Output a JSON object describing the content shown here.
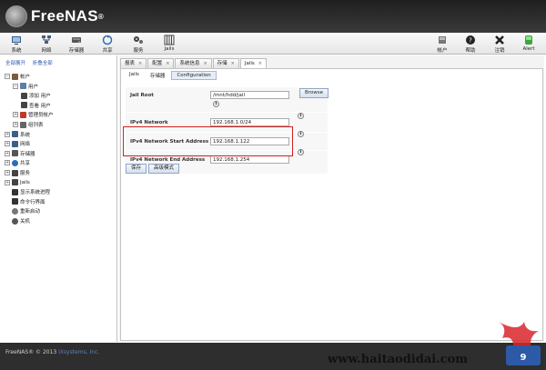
{
  "app": {
    "name": "FreeNAS",
    "trademark": "®"
  },
  "toolbar": {
    "left": [
      {
        "name": "toolbar-system-button",
        "icon": "system-icon",
        "label": "系统"
      },
      {
        "name": "toolbar-network-button",
        "icon": "network-icon",
        "label": "网络"
      },
      {
        "name": "toolbar-storage-button",
        "icon": "storage-icon",
        "label": "存储器"
      },
      {
        "name": "toolbar-sharing-button",
        "icon": "sharing-icon",
        "label": "共享"
      },
      {
        "name": "toolbar-services-button",
        "icon": "services-icon",
        "label": "服务"
      },
      {
        "name": "toolbar-jails-button",
        "icon": "jails-icon",
        "label": "Jails"
      }
    ],
    "right": [
      {
        "name": "toolbar-account-button",
        "icon": "account-icon",
        "label": "帐户"
      },
      {
        "name": "toolbar-help-button",
        "icon": "help-icon",
        "label": "帮助"
      },
      {
        "name": "toolbar-logout-button",
        "icon": "logout-icon",
        "label": "注销"
      },
      {
        "name": "toolbar-alert-button",
        "icon": "alert-icon",
        "label": "Alert"
      }
    ]
  },
  "sidebar": {
    "expand_all": "全部展开",
    "collapse_all": "折叠全部",
    "tree": [
      {
        "label": "帐户",
        "level": 0,
        "toggle": "−",
        "icon": "account-icon"
      },
      {
        "label": "用户",
        "level": 1,
        "toggle": "−",
        "icon": "users-icon"
      },
      {
        "label": "添加 用户",
        "level": 2,
        "toggle": "",
        "icon": "add-user-icon"
      },
      {
        "label": "查看 用户",
        "level": 2,
        "toggle": "",
        "icon": "view-users-icon"
      },
      {
        "label": "管理员帐户",
        "level": 1,
        "toggle": "+",
        "icon": "admin-icon"
      },
      {
        "label": "组列表",
        "level": 1,
        "toggle": "+",
        "icon": "groups-icon"
      },
      {
        "label": "系统",
        "level": 0,
        "toggle": "+",
        "icon": "system-icon"
      },
      {
        "label": "网络",
        "level": 0,
        "toggle": "+",
        "icon": "network-icon"
      },
      {
        "label": "存储器",
        "level": 0,
        "toggle": "+",
        "icon": "storage-icon"
      },
      {
        "label": "共享",
        "level": 0,
        "toggle": "+",
        "icon": "sharing-icon"
      },
      {
        "label": "服务",
        "level": 0,
        "toggle": "+",
        "icon": "services-icon"
      },
      {
        "label": "Jails",
        "level": 0,
        "toggle": "+",
        "icon": "jails-icon"
      },
      {
        "label": "显示系统进程",
        "level": 0,
        "toggle": "",
        "icon": "process-icon"
      },
      {
        "label": "命令行界面",
        "level": 0,
        "toggle": "",
        "icon": "shell-icon"
      },
      {
        "label": "重新启动",
        "level": 0,
        "toggle": "",
        "icon": "reboot-icon"
      },
      {
        "label": "关机",
        "level": 0,
        "toggle": "",
        "icon": "shutdown-icon"
      }
    ]
  },
  "tabs": [
    {
      "label": "报表",
      "close": "×"
    },
    {
      "label": "配置",
      "close": "×"
    },
    {
      "label": "系统信息",
      "close": "×"
    },
    {
      "label": "存储",
      "close": "×"
    },
    {
      "label": "Jails",
      "close": "×"
    }
  ],
  "subtabs": [
    "Jails",
    "存储器",
    "Configuration"
  ],
  "form": {
    "jail_root": {
      "label": "Jail Root",
      "value": "/mnt/hdd/jail"
    },
    "browse_label": "Browse",
    "ipv4_network": {
      "label": "IPv4 Network",
      "value": "192.168.1.0/24"
    },
    "ipv4_start": {
      "label": "IPv4 Network Start Address",
      "value": "192.168.1.122"
    },
    "ipv4_end": {
      "label": "IPv4 Network End Address",
      "value": "192.168.1.254"
    },
    "info_glyph": "i",
    "save_label": "保存",
    "advanced_label": "高级模式"
  },
  "footer": {
    "copyright": "FreeNAS® © 2013 ",
    "company": "iXsystems, Inc."
  },
  "watermark": {
    "text": "www.haitaodidai.com"
  },
  "colors": {
    "highlight": "#d21f1f",
    "header_bg": "#2a2a2a",
    "link": "#2a56b0"
  }
}
